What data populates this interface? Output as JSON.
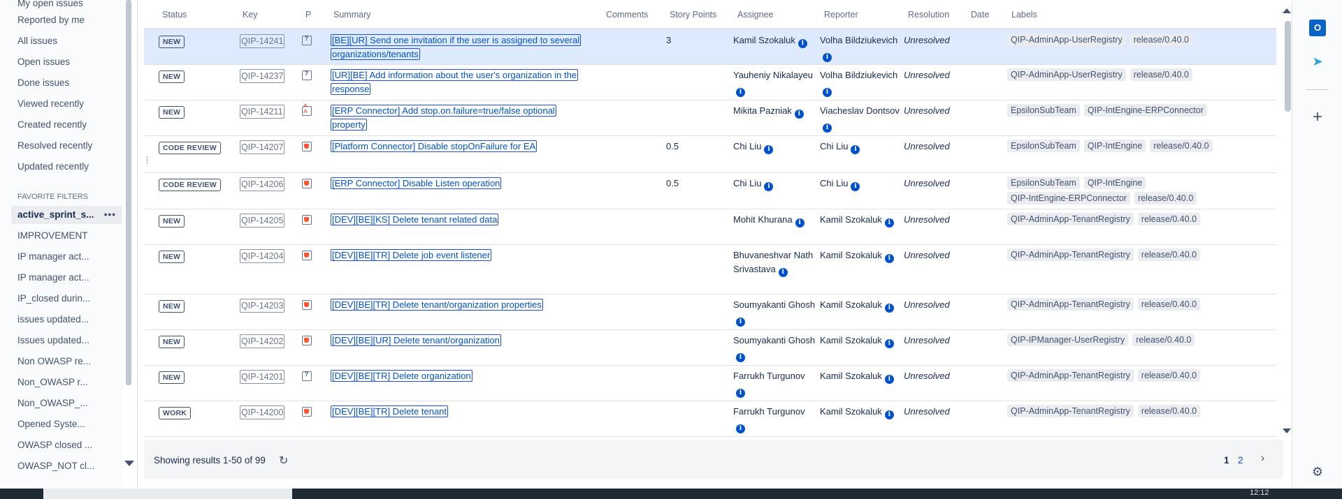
{
  "sidebar": {
    "items": [
      {
        "label": "My open issues"
      },
      {
        "label": "Reported by me"
      },
      {
        "label": "All issues"
      },
      {
        "label": "Open issues"
      },
      {
        "label": "Done issues"
      },
      {
        "label": "Viewed recently"
      },
      {
        "label": "Created recently"
      },
      {
        "label": "Resolved recently"
      },
      {
        "label": "Updated recently"
      }
    ],
    "favorite_title": "FAVORITE FILTERS",
    "favorites": [
      {
        "label": "active_sprint_s..."
      },
      {
        "label": "IMPROVEMENT"
      },
      {
        "label": "IP manager act..."
      },
      {
        "label": "IP manager act..."
      },
      {
        "label": "IP_closed durin..."
      },
      {
        "label": "issues updated..."
      },
      {
        "label": "Issues updated..."
      },
      {
        "label": "Non OWASP re..."
      },
      {
        "label": "Non_OWASP r..."
      },
      {
        "label": "Non_OWASP_..."
      },
      {
        "label": "Opened Syste..."
      },
      {
        "label": "OWASP closed ..."
      },
      {
        "label": "OWASP_NOT cl..."
      }
    ],
    "more_icon": "•••"
  },
  "columns": {
    "status": "Status",
    "key": "Key",
    "p": "P",
    "summary": "Summary",
    "comments": "Comments",
    "story_points": "Story Points",
    "assignee": "Assignee",
    "reporter": "Reporter",
    "resolution": "Resolution",
    "date": "Date",
    "labels": "Labels"
  },
  "rows": [
    {
      "status": "NEW",
      "key": "QIP-14241",
      "priority": "unknown",
      "summary": "[BE][UR] Send one invitation if the user is assigned to several organizations/tenants",
      "story_points": "3",
      "assignee": "Kamil Szokaluk",
      "reporter": "Volha Bildziukevich",
      "resolution": "Unresolved",
      "labels": [
        "QIP-AdminApp-UserRegistry",
        "release/0.40.0"
      ]
    },
    {
      "status": "NEW",
      "key": "QIP-14237",
      "priority": "unknown",
      "summary": "[UR][BE] Add information about the user's organization in the response",
      "story_points": "",
      "assignee": "Yauheniy Nikalayeu",
      "reporter": "Volha Bildziukevich",
      "resolution": "Unresolved",
      "labels": [
        "QIP-AdminApp-UserRegistry",
        "release/0.40.0"
      ]
    },
    {
      "status": "NEW",
      "key": "QIP-14211",
      "priority": "highest",
      "summary": "[ERP Connector] Add stop.on.failure=true/false optional property",
      "story_points": "",
      "assignee": "Mikita Pazniak",
      "reporter": "Viacheslav Dontsov",
      "resolution": "Unresolved",
      "labels": [
        "EpsilonSubTeam",
        "QIP-IntEngine-ERPConnector"
      ]
    },
    {
      "status": "CODE REVIEW",
      "key": "QIP-14207",
      "priority": "medium",
      "summary": "[Platform Connector] Disable stopOnFailure for EA",
      "story_points": "0.5",
      "assignee": "Chi Liu",
      "reporter": "Chi Liu",
      "resolution": "Unresolved",
      "labels": [
        "EpsilonSubTeam",
        "QIP-IntEngine",
        "release/0.40.0"
      ]
    },
    {
      "status": "CODE REVIEW",
      "key": "QIP-14206",
      "priority": "medium",
      "summary": "[ERP Connector] Disable Listen operation",
      "story_points": "0.5",
      "assignee": "Chi Liu",
      "reporter": "Chi Liu",
      "resolution": "Unresolved",
      "labels": [
        "EpsilonSubTeam",
        "QIP-IntEngine",
        "QIP-IntEngine-ERPConnector",
        "release/0.40.0"
      ]
    },
    {
      "status": "NEW",
      "key": "QIP-14205",
      "priority": "medium",
      "summary": "[DEV][BE][KS] Delete tenant related data",
      "story_points": "",
      "assignee": "Mohit Khurana",
      "reporter": "Kamil Szokaluk",
      "resolution": "Unresolved",
      "labels": [
        "QIP-AdminApp-TenantRegistry",
        "release/0.40.0"
      ]
    },
    {
      "status": "NEW",
      "key": "QIP-14204",
      "priority": "medium",
      "summary": "[DEV][BE][TR] Delete job event listener",
      "story_points": "",
      "assignee": "Bhuvaneshvar Nath Srivastava",
      "reporter": "Kamil Szokaluk",
      "resolution": "Unresolved",
      "labels": [
        "QIP-AdminApp-TenantRegistry",
        "release/0.40.0"
      ]
    },
    {
      "status": "NEW",
      "key": "QIP-14203",
      "priority": "medium",
      "summary": "[DEV][BE][TR] Delete tenant/organization properties",
      "story_points": "",
      "assignee": "Soumyakanti Ghosh",
      "reporter": "Kamil Szokaluk",
      "resolution": "Unresolved",
      "labels": [
        "QIP-AdminApp-TenantRegistry",
        "release/0.40.0"
      ]
    },
    {
      "status": "NEW",
      "key": "QIP-14202",
      "priority": "medium",
      "summary": "[DEV][BE][UR] Delete tenant/organization",
      "story_points": "",
      "assignee": "Soumyakanti Ghosh",
      "reporter": "Kamil Szokaluk",
      "resolution": "Unresolved",
      "labels": [
        "QIP-IPManager-UserRegistry",
        "release/0.40.0"
      ]
    },
    {
      "status": "NEW",
      "key": "QIP-14201",
      "priority": "unknown",
      "summary": "[DEV][BE][TR] Delete organization",
      "story_points": "",
      "assignee": "Farrukh Turgunov",
      "reporter": "Kamil Szokaluk",
      "resolution": "Unresolved",
      "labels": [
        "QIP-AdminApp-TenantRegistry",
        "release/0.40.0"
      ]
    },
    {
      "status": "WORK",
      "key": "QIP-14200",
      "priority": "medium",
      "summary": "[DEV][BE][TR] Delete tenant",
      "story_points": "",
      "assignee": "Farrukh Turgunov",
      "reporter": "Kamil Szokaluk",
      "resolution": "Unresolved",
      "labels": [
        "QIP-AdminApp-TenantRegistry",
        "release/0.40.0"
      ]
    }
  ],
  "footer": {
    "showing": "Showing results 1-50 of 99",
    "page_1": "1",
    "page_2": "2"
  },
  "taskbar": {
    "clock": "12:12"
  },
  "right_rail": {
    "outlook_letter": "O"
  }
}
